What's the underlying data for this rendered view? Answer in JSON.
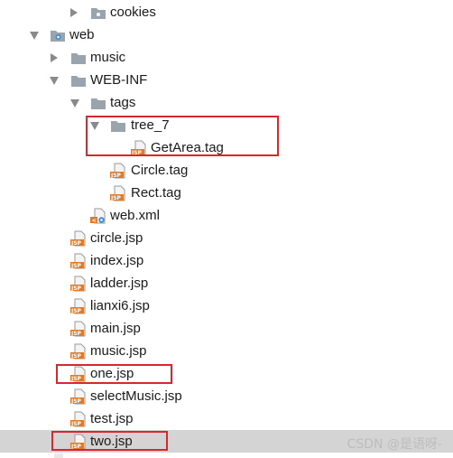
{
  "tree": {
    "items": [
      {
        "label": "cookies",
        "kind": "folder",
        "expanded": false
      },
      {
        "label": "web",
        "kind": "webfolder",
        "expanded": true
      },
      {
        "label": "music",
        "kind": "folder",
        "expanded": false
      },
      {
        "label": "WEB-INF",
        "kind": "folder",
        "expanded": true
      },
      {
        "label": "tags",
        "kind": "folder",
        "expanded": true
      },
      {
        "label": "tree_7",
        "kind": "folder",
        "expanded": true
      },
      {
        "label": "GetArea.tag",
        "kind": "jsp"
      },
      {
        "label": "Circle.tag",
        "kind": "jsp"
      },
      {
        "label": "Rect.tag",
        "kind": "jsp"
      },
      {
        "label": "web.xml",
        "kind": "xml"
      },
      {
        "label": "circle.jsp",
        "kind": "jsp"
      },
      {
        "label": "index.jsp",
        "kind": "jsp"
      },
      {
        "label": "ladder.jsp",
        "kind": "jsp"
      },
      {
        "label": "lianxi6.jsp",
        "kind": "jsp"
      },
      {
        "label": "main.jsp",
        "kind": "jsp"
      },
      {
        "label": "music.jsp",
        "kind": "jsp"
      },
      {
        "label": "one.jsp",
        "kind": "jsp"
      },
      {
        "label": "selectMusic.jsp",
        "kind": "jsp"
      },
      {
        "label": "test.jsp",
        "kind": "jsp"
      },
      {
        "label": "two.jsp",
        "kind": "jsp",
        "selected": true
      }
    ]
  },
  "icons": {
    "jsp_text": "JSP",
    "xml_text": "<"
  },
  "colors": {
    "highlight": "#d9272e",
    "selected_row": "#d4d4d4",
    "folder": "#9aa4ad",
    "jsp_badge": "#e07b2a"
  },
  "watermark": "CSDN @是语呀-"
}
